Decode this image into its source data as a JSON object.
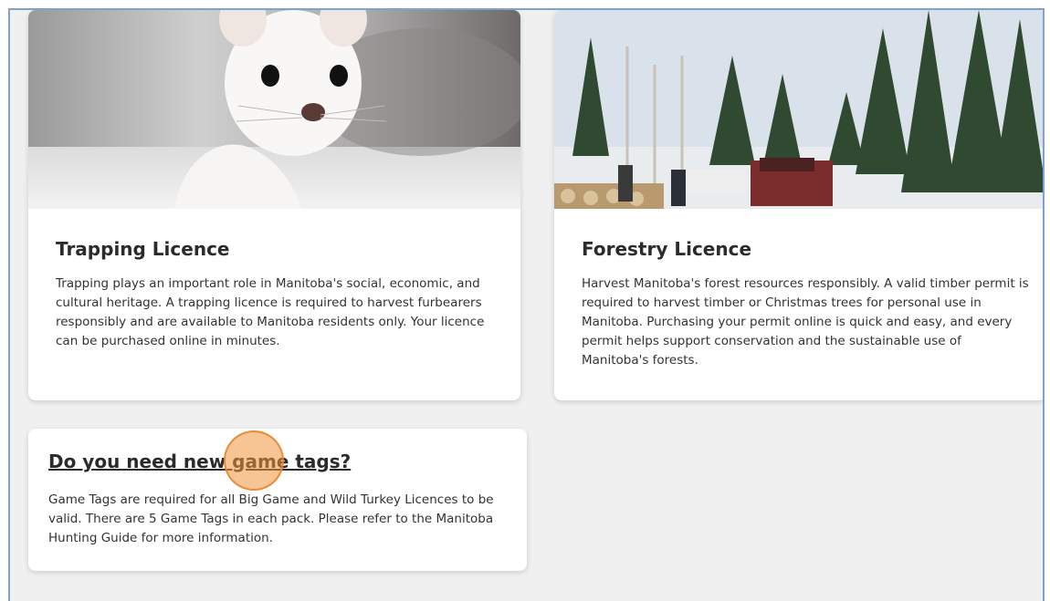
{
  "cards": [
    {
      "title": "Trapping Licence",
      "body": "Trapping plays an important role in Manitoba's social, economic, and cultural heritage. A trapping licence is required to harvest furbearers responsibly and are available to Manitoba residents only. Your licence can be purchased online in minutes.",
      "image": "ermine-photo"
    },
    {
      "title": "Forestry Licence",
      "body": "Harvest Manitoba's forest resources responsibly. A valid timber permit is required to harvest timber or Christmas trees for personal use in Manitoba. Purchasing your permit online is quick and easy, and every permit helps support conservation and the sustainable use of Manitoba's forests.",
      "image": "forest-photo"
    },
    {
      "title": "Do you need new game tags?",
      "body": "Game Tags are required for all Big Game and Wild Turkey Licences to be valid. There are 5 Game Tags in each pack. Please refer to the Manitoba Hunting Guide for more information."
    }
  ],
  "colors": {
    "accent": "#f0963c",
    "frame_border": "#7fa3cf",
    "background": "#f0f0f0"
  }
}
